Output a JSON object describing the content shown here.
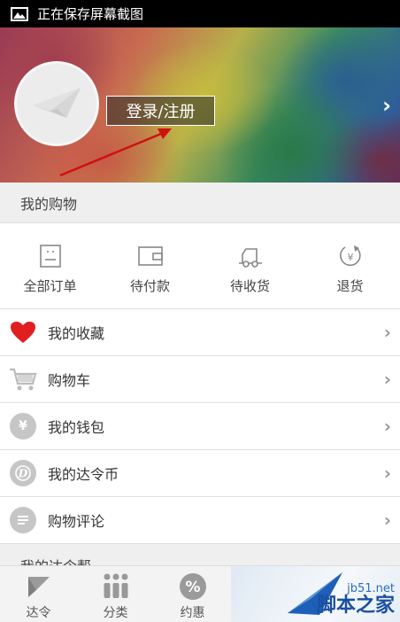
{
  "status_bar": {
    "text": "正在保存屏幕截图",
    "icon": "picture-icon"
  },
  "header": {
    "login_label": "登录/注册",
    "chevron": "›"
  },
  "shopping_section": {
    "title": "我的购物"
  },
  "orders": [
    {
      "label": "全部订单",
      "icon": "all-orders-icon"
    },
    {
      "label": "待付款",
      "icon": "wallet-icon"
    },
    {
      "label": "待收货",
      "icon": "truck-icon"
    },
    {
      "label": "退货",
      "icon": "refund-icon"
    }
  ],
  "list": [
    {
      "label": "我的收藏",
      "icon": "heart-icon",
      "icon_color": "#e02020"
    },
    {
      "label": "购物车",
      "icon": "cart-icon",
      "icon_color": "#bbbbbb"
    },
    {
      "label": "我的钱包",
      "icon": "yen-coin-icon",
      "icon_color": "#c6c6c6"
    },
    {
      "label": "我的达令币",
      "icon": "d-coin-icon",
      "icon_color": "#c6c6c6"
    },
    {
      "label": "购物评论",
      "icon": "comment-icon",
      "icon_color": "#c6c6c6"
    }
  ],
  "help_section": {
    "title": "我的达令帮"
  },
  "bottom_nav": [
    {
      "label": "达令",
      "icon": "flag-icon"
    },
    {
      "label": "分类",
      "icon": "category-icon"
    },
    {
      "label": "约惠",
      "icon": "percent-icon"
    }
  ],
  "watermark": {
    "url": "jb51.net",
    "name": "脚本之家"
  },
  "colors": {
    "status_bar": "#000000",
    "annotation_arrow": "#d01010",
    "section_bg": "#efefef"
  }
}
